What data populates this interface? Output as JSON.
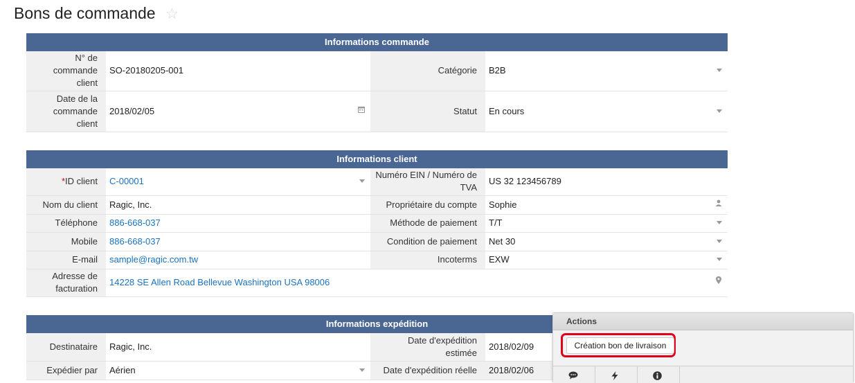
{
  "page": {
    "title": "Bons de commande"
  },
  "sections": {
    "commande": {
      "title": "Informations commande",
      "rows": [
        {
          "l1": "N° de commande client",
          "v1": "SO-20180205-001",
          "l2": "Catégorie",
          "v2": "B2B"
        },
        {
          "l1": "Date de la commande client",
          "v1": "2018/02/05",
          "l2": "Statut",
          "v2": "En cours"
        }
      ]
    },
    "client": {
      "title": "Informations client",
      "rows": [
        {
          "l1": "ID client",
          "v1": "C-00001",
          "l2": "Numéro EIN / Numéro de TVA",
          "v2": "US 32 123456789"
        },
        {
          "l1": "Nom du client",
          "v1": "Ragic, Inc.",
          "l2": "Propriétaire du compte",
          "v2": "Sophie"
        },
        {
          "l1": "Téléphone",
          "v1": "886-668-037",
          "l2": "Méthode de paiement",
          "v2": "T/T"
        },
        {
          "l1": "Mobile",
          "v1": "886-668-037",
          "l2": "Condition de paiement",
          "v2": "Net 30"
        },
        {
          "l1": "E-mail",
          "v1": "sample@ragic.com.tw",
          "l2": "Incoterms",
          "v2": "EXW"
        },
        {
          "l1": "Adresse de facturation",
          "v1": "14228 SE Allen Road Bellevue Washington USA 98006"
        }
      ]
    },
    "expedition": {
      "title": "Informations expédition",
      "rows": [
        {
          "l1": "Destinataire",
          "v1": "Ragic, Inc.",
          "l2": "Date d'expédition estimée",
          "v2": "2018/02/09"
        },
        {
          "l1": "Expédier par",
          "v1": "Aérien",
          "l2": "Date d'expédition réelle",
          "v2": "2018/02/06"
        }
      ]
    }
  },
  "actions": {
    "title": "Actions",
    "button_label": "Création bon de livraison"
  },
  "colors": {
    "header": "#4a6794",
    "link": "#1a73c0",
    "highlight": "#e0001a"
  }
}
